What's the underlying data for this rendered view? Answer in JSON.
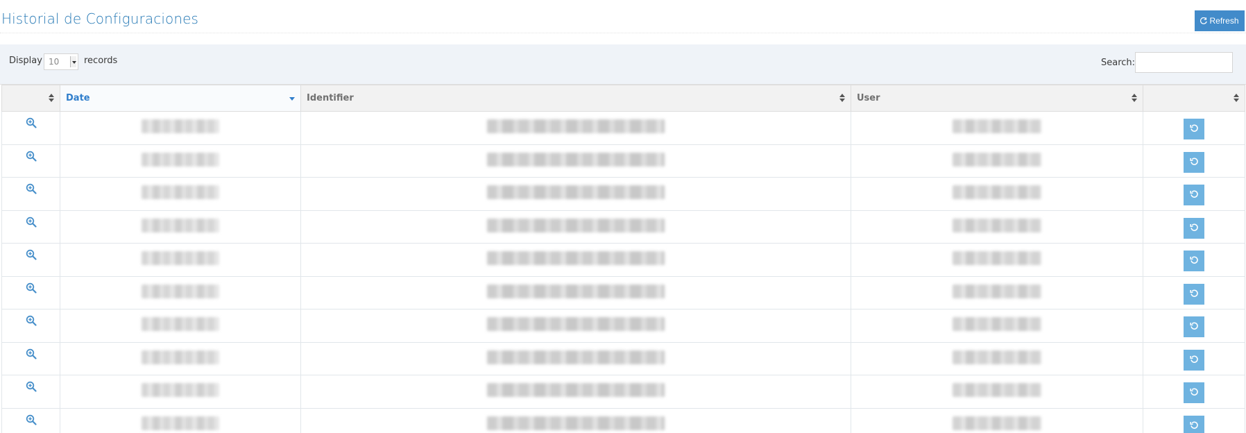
{
  "header": {
    "title": "Historial de Configuraciones",
    "refresh_label": "Refresh"
  },
  "toolbar": {
    "display_label": "Display",
    "records_label": "records",
    "page_length": "10",
    "search_label": "Search:",
    "search_value": ""
  },
  "table": {
    "columns": [
      {
        "label": ""
      },
      {
        "label": "Date"
      },
      {
        "label": "Identifier"
      },
      {
        "label": "User"
      },
      {
        "label": ""
      }
    ],
    "sorted_column": "Date",
    "sort_direction": "desc",
    "row_count": 10
  },
  "icons": {
    "view": "zoom-in-icon",
    "restore": "undo-icon",
    "refresh": "refresh-icon"
  },
  "colors": {
    "title": "#2679b5",
    "primary_button": "#428bca",
    "row_action_button": "#6fb3e0",
    "toolbar_bg": "#eff3f8",
    "sorted_header": "#307ecc"
  }
}
